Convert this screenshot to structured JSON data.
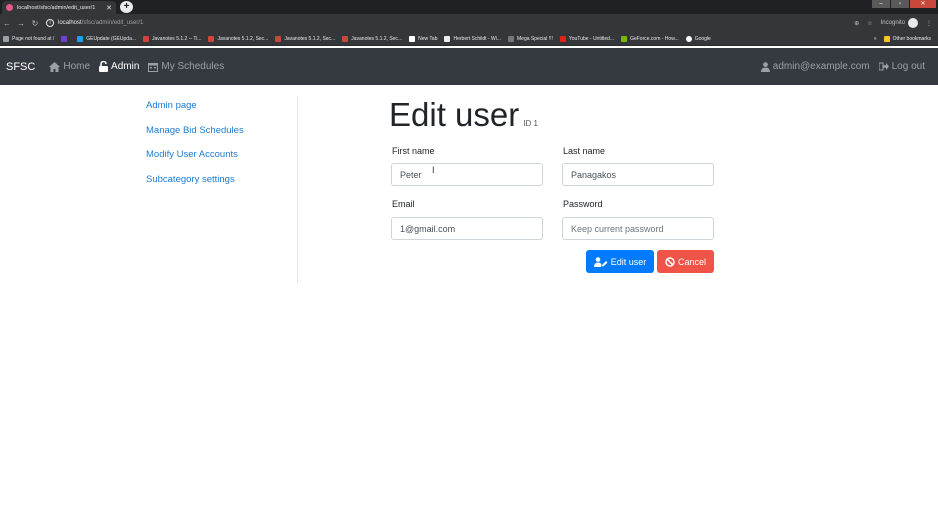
{
  "browser": {
    "tab_title": "localhost/sfsc/admin/edit_user/1",
    "url_host": "localhost",
    "url_path": "/sfsc/admin/edit_user/1",
    "incognito_label": "Incognito",
    "bookmarks": [
      "Page not found at /",
      "GEUpdate (GEUpda...",
      "Javanotes 5.1.2 -- Ti...",
      "Javanotes 5.1.2, Sec...",
      "Javanotes 5.1.2, Sec...",
      "Javanotes 5.1.2, Sec...",
      "New Tab",
      "Herbert Schildt - Wi...",
      "Mega Special !!!",
      "YouTube - Untitled...",
      "GeForce.com - How...",
      "Google"
    ],
    "other_bookmarks": "Other bookmarks"
  },
  "navbar": {
    "brand": "SFSC",
    "home": "Home",
    "admin": "Admin",
    "schedules": "My Schedules",
    "user": "admin@example.com",
    "logout": "Log out"
  },
  "sidebar": {
    "items": [
      {
        "label": "Admin page"
      },
      {
        "label": "Manage Bid Schedules"
      },
      {
        "label": "Modify User Accounts"
      },
      {
        "label": "Subcategory settings"
      }
    ]
  },
  "form": {
    "title": "Edit user",
    "id_label": "ID 1",
    "first_name_label": "First name",
    "first_name_value": "Peter",
    "last_name_label": "Last name",
    "last_name_value": "Panagakos",
    "email_label": "Email",
    "email_value": "1@gmail.com",
    "password_label": "Password",
    "password_placeholder": "Keep current password",
    "submit_label": "Edit user",
    "cancel_label": "Cancel"
  },
  "colors": {
    "navbar_bg": "#343a40",
    "link": "#1e7bd1",
    "primary": "#007bff",
    "danger": "#f05348"
  }
}
